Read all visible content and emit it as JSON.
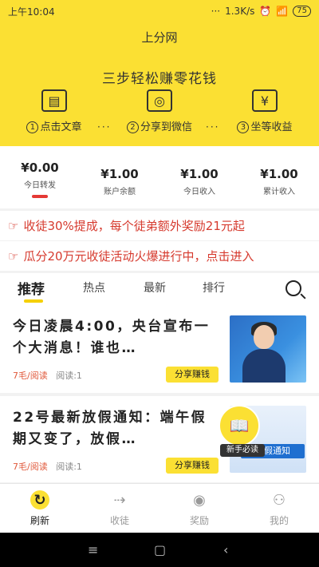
{
  "status_bar": {
    "time": "上午10:04",
    "dots": "···",
    "speed": "1.3K/s",
    "battery": "75"
  },
  "app": {
    "title": "上分网",
    "slogan": "三步轻松赚零花钱"
  },
  "steps": [
    {
      "num": "1",
      "label": "点击文章",
      "icon": "article-icon"
    },
    {
      "num": "2",
      "label": "分享到微信",
      "icon": "wechat-icon"
    },
    {
      "num": "3",
      "label": "坐等收益",
      "icon": "yuan-icon"
    }
  ],
  "step_separator": "···",
  "balances": [
    {
      "value": "¥0.00",
      "label": "今日转发"
    },
    {
      "value": "¥1.00",
      "label": "账户余额"
    },
    {
      "value": "¥1.00",
      "label": "今日收入"
    },
    {
      "value": "¥1.00",
      "label": "累计收入"
    }
  ],
  "promos": [
    {
      "text": "收徒30%提成，每个徒弟额外奖励21元起"
    },
    {
      "text": "瓜分20万元收徒活动火爆进行中，点击进入"
    }
  ],
  "tabs": [
    {
      "label": "推荐",
      "active": true
    },
    {
      "label": "热点"
    },
    {
      "label": "最新"
    },
    {
      "label": "排行"
    }
  ],
  "articles": [
    {
      "title": "今日凌晨4:00，央台宣布一个大消息！谁也…",
      "price": "7毛/阅读",
      "reads": "阅读:1",
      "share": "分享赚钱"
    },
    {
      "title": "22号最新放假通知：端午假期又变了，放假…",
      "price": "7毛/阅读",
      "reads": "阅读:1",
      "share": "分享赚钱",
      "thumb_banner": "放假通知"
    }
  ],
  "floating_reader": {
    "label": "新手必读"
  },
  "bottom_nav": [
    {
      "label": "刷新",
      "icon": "refresh-icon",
      "active": true
    },
    {
      "label": "收徒",
      "icon": "share-user-icon"
    },
    {
      "label": "奖励",
      "icon": "eye-icon"
    },
    {
      "label": "我的",
      "icon": "user-icon"
    }
  ],
  "colors": {
    "accent": "#fbe033",
    "promo_text": "#d63a2e",
    "price": "#e0583a"
  }
}
